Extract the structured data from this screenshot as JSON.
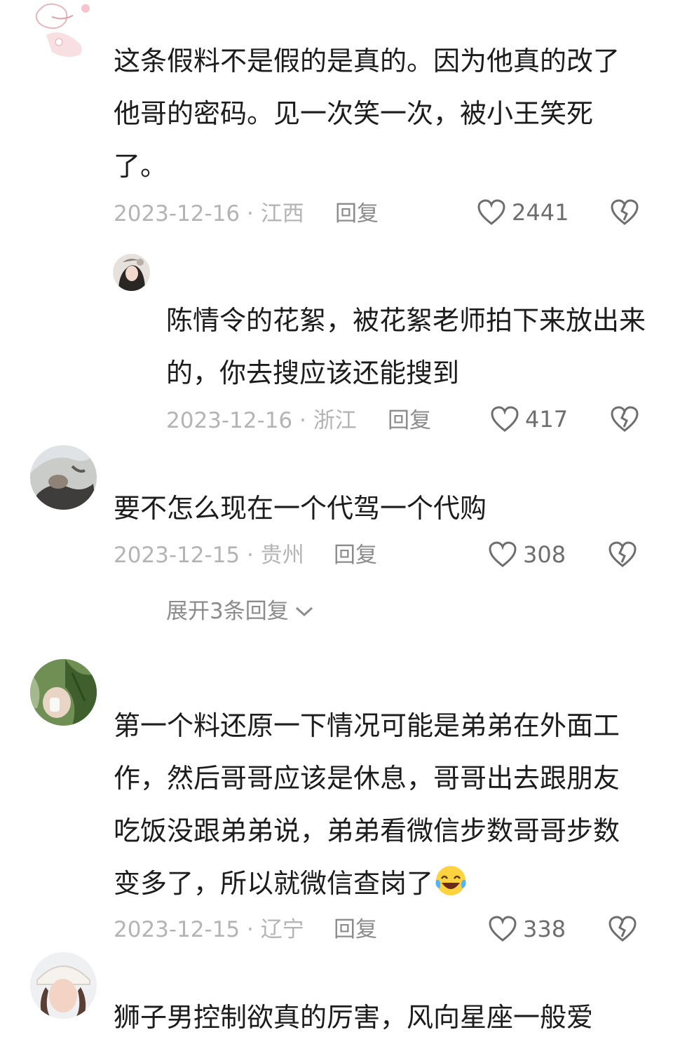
{
  "comments": [
    {
      "text": "这条假料不是假的是真的。因为他真的改了他哥的密码。见一次笑一次，被小王笑死了。",
      "date": "2023-12-16",
      "location": "江西",
      "reply_label": "回复",
      "likes": "2441"
    },
    {
      "text": "陈情令的花絮，被花絮老师拍下来放出来的，你去搜应该还能搜到",
      "date": "2023-12-16",
      "location": "浙江",
      "reply_label": "回复",
      "likes": "417"
    },
    {
      "text": "要不怎么现在一个代驾一个代购",
      "date": "2023-12-15",
      "location": "贵州",
      "reply_label": "回复",
      "likes": "308"
    },
    {
      "text": "第一个料还原一下情况可能是弟弟在外面工作，然后哥哥应该是休息，哥哥出去跟朋友吃饭没跟弟弟说，弟弟看微信步数哥哥步数变多了，所以就微信查岗了",
      "date": "2023-12-15",
      "location": "辽宁",
      "reply_label": "回复",
      "likes": "338"
    },
    {
      "text": "狮子男控制欲真的厉害，风向星座一般爱"
    }
  ],
  "expand_label": "展开3条回复",
  "icons": {
    "like": "heart-outline-icon",
    "dislike": "broken-heart-icon",
    "expand": "chevron-down-icon",
    "emoji": "laughing-tears-emoji"
  },
  "colors": {
    "meta_text": "#b4b4b4",
    "secondary_text": "#8c8c8c",
    "icon_stroke": "#6e6e6e"
  }
}
